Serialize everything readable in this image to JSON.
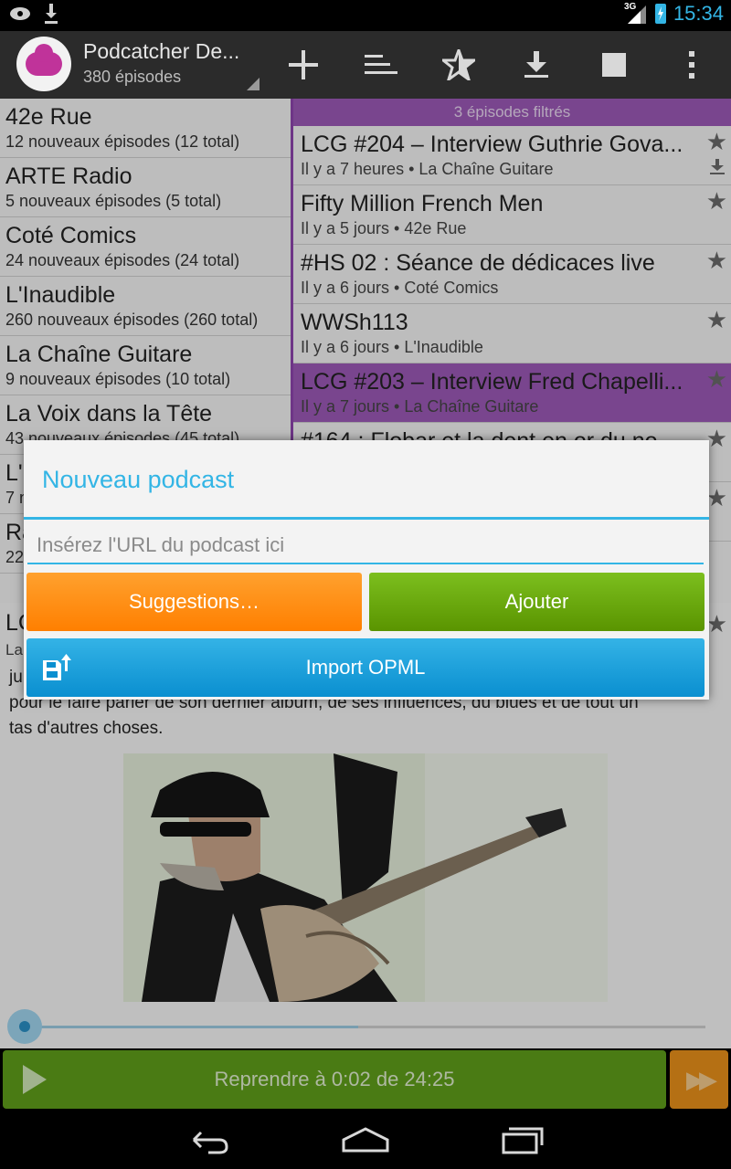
{
  "status_bar": {
    "time": "15:34",
    "network": "3G"
  },
  "action_bar": {
    "title": "Podcatcher De...",
    "subtitle": "380 épisodes",
    "icons": [
      "add-icon",
      "sort-icon",
      "star-icon",
      "download-icon",
      "stop-icon",
      "overflow-menu-icon"
    ]
  },
  "podcasts": [
    {
      "name": "42e Rue",
      "count": "12 nouveaux épisodes (12 total)"
    },
    {
      "name": "ARTE Radio",
      "count": "5 nouveaux épisodes (5 total)"
    },
    {
      "name": "Coté Comics",
      "count": "24 nouveaux épisodes (24 total)"
    },
    {
      "name": "L'Inaudible",
      "count": "260 nouveaux épisodes (260 total)"
    },
    {
      "name": "La Chaîne Guitare",
      "count": "9 nouveaux épisodes (10 total)"
    },
    {
      "name": "La Voix dans la Tête",
      "count": "43 nouveaux épisodes (45 total)"
    },
    {
      "name": "L'",
      "count": "7 n"
    },
    {
      "name": "Ra",
      "count": "22"
    }
  ],
  "episodes": {
    "filter_label": "3 épisodes filtrés",
    "items": [
      {
        "title": "LCG #204 – Interview Guthrie Gova...",
        "meta": "Il y a 7 heures • La Chaîne Guitare"
      },
      {
        "title": "Fifty Million French Men",
        "meta": "Il y a 5 jours • 42e Rue"
      },
      {
        "title": "#HS 02 : Séance de dédicaces live",
        "meta": "Il y a 6 jours • Coté Comics"
      },
      {
        "title": "WWSh113",
        "meta": "Il y a 6 jours • L'Inaudible"
      },
      {
        "title": "LCG #203 – Interview Fred Chapelli...",
        "meta": "Il y a 7 jours • La Chaîne Guitare"
      },
      {
        "title": "#164 : Flobar et la dent en or du no...",
        "meta": ""
      }
    ]
  },
  "detail": {
    "title": "LC",
    "subtitle": "La",
    "text_line1": "ju",
    "text_line2": "pour le faire parler de son dernier album, de ses influences, du blues et de tout un",
    "text_line3": "tas d'autres choses."
  },
  "player": {
    "label": "Reprendre à 0:02 de 24:25",
    "progress_fraction": 0.49
  },
  "dialog": {
    "title": "Nouveau podcast",
    "url_placeholder": "Insérez l'URL du podcast ici",
    "suggestions_label": "Suggestions…",
    "add_label": "Ajouter",
    "import_label": "Import OPML"
  },
  "colors": {
    "accent": "#33b5e5",
    "selected": "#9b59b6",
    "suggest": "#ff8c00",
    "add": "#6aa80e",
    "opml": "#1aa0dc",
    "play": "#5f9e1a",
    "skip": "#e8901a"
  }
}
